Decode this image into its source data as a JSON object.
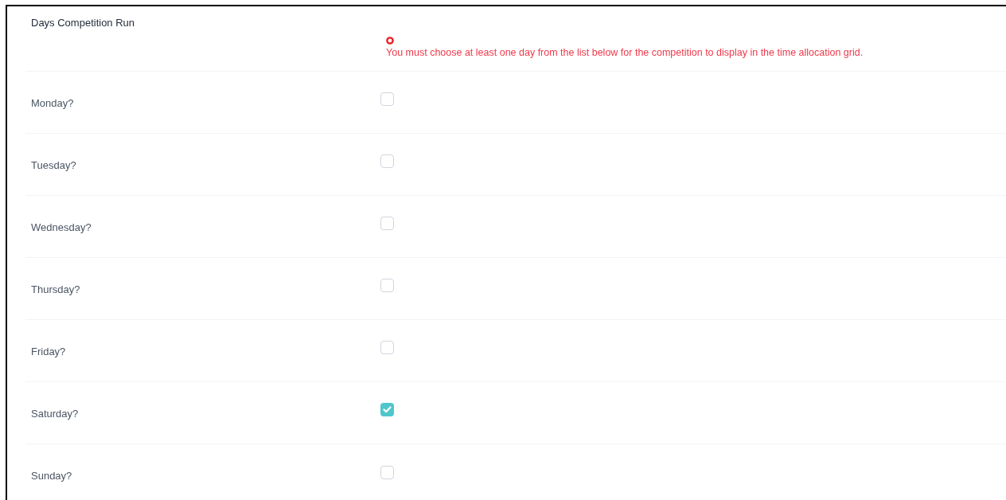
{
  "section": {
    "title": "Days Competition Run",
    "error": "You must choose at least one day from the list below for the competition to display in the time allocation grid."
  },
  "days": [
    {
      "label": "Monday?",
      "checked": false
    },
    {
      "label": "Tuesday?",
      "checked": false
    },
    {
      "label": "Wednesday?",
      "checked": false
    },
    {
      "label": "Thursday?",
      "checked": false
    },
    {
      "label": "Friday?",
      "checked": false
    },
    {
      "label": "Saturday?",
      "checked": true
    },
    {
      "label": "Sunday?",
      "checked": false
    }
  ]
}
